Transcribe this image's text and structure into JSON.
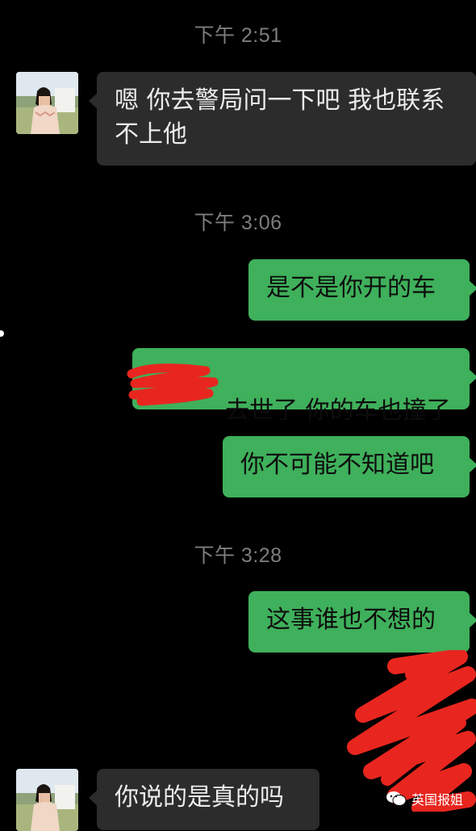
{
  "timestamps": [
    "下午 2:51",
    "下午 3:06",
    "下午 3:28"
  ],
  "messages": [
    {
      "side": "in",
      "text": "嗯 你去警局问一下吧 我也联系\n不上他"
    },
    {
      "side": "out",
      "text": "是不是你开的车"
    },
    {
      "side": "out",
      "text": "去世了 你的车也撞了"
    },
    {
      "side": "out",
      "text": "你不可能不知道吧"
    },
    {
      "side": "out",
      "text": "这事谁也不想的"
    },
    {
      "side": "in",
      "text": "你说的是真的吗"
    }
  ],
  "watermark": {
    "text": "英国报姐",
    "icon": "wechat-icon"
  },
  "colors": {
    "background": "#000000",
    "incoming_bubble": "#2c2c2c",
    "outgoing_bubble": "#3fb05b",
    "timestamp": "#7d7d7d",
    "redaction": "#e8261f"
  }
}
